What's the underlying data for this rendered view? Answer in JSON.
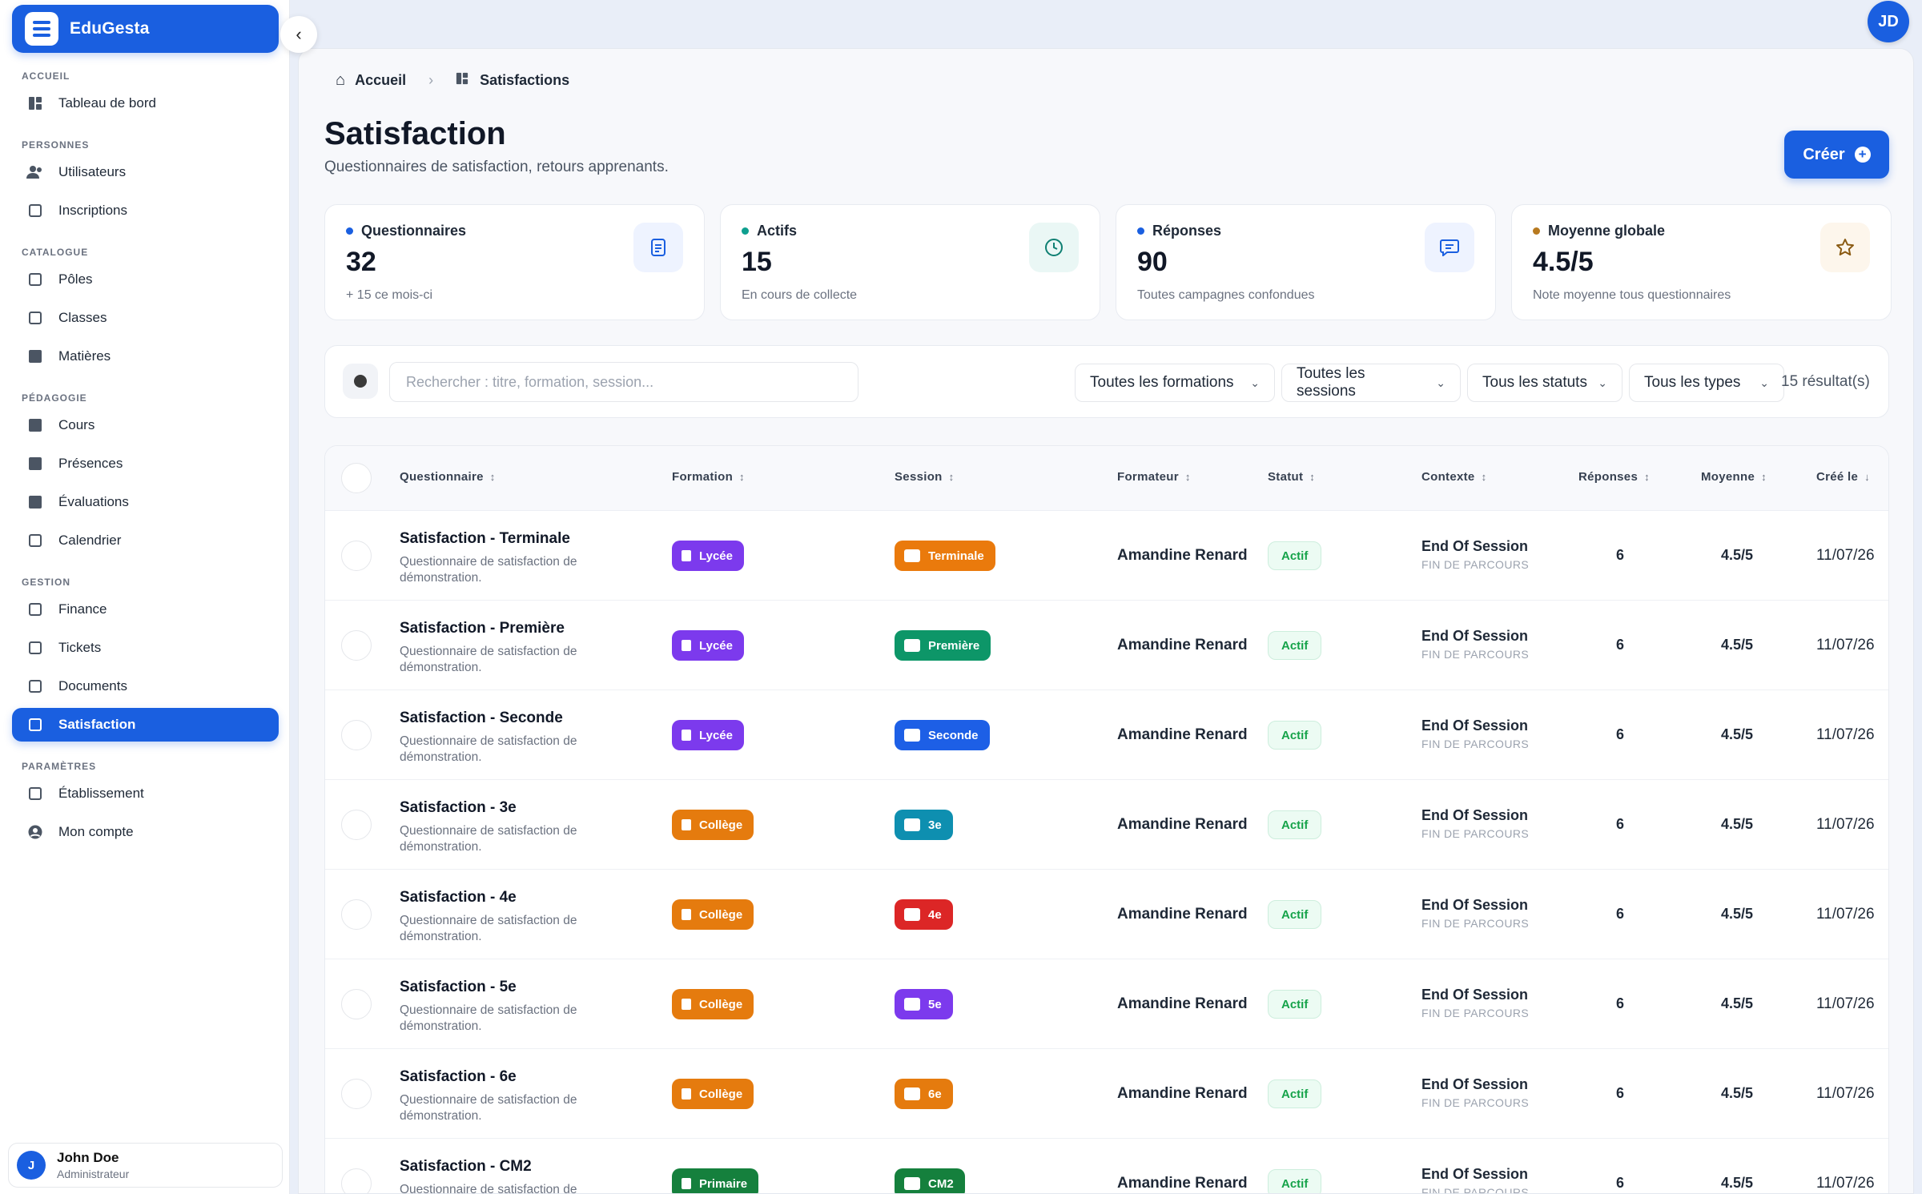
{
  "app": {
    "name": "EduGesta",
    "user_initials": "JD"
  },
  "sidebar": {
    "sections": [
      {
        "label": "ACCUEIL",
        "items": [
          {
            "label": "Tableau de bord",
            "icon": "dashboard-icon"
          }
        ]
      },
      {
        "label": "PERSONNES",
        "items": [
          {
            "label": "Utilisateurs",
            "icon": "users-icon"
          },
          {
            "label": "Inscriptions",
            "icon": "inscriptions-icon"
          }
        ]
      },
      {
        "label": "CATALOGUE",
        "items": [
          {
            "label": "Pôles",
            "icon": "poles-icon"
          },
          {
            "label": "Classes",
            "icon": "classes-icon"
          },
          {
            "label": "Matières",
            "icon": "book-icon"
          }
        ]
      },
      {
        "label": "PÉDAGOGIE",
        "items": [
          {
            "label": "Cours",
            "icon": "cubes-icon"
          },
          {
            "label": "Présences",
            "icon": "clipboard-icon"
          },
          {
            "label": "Évaluations",
            "icon": "evaluation-icon"
          },
          {
            "label": "Calendrier",
            "icon": "calendar-icon"
          }
        ]
      },
      {
        "label": "GESTION",
        "items": [
          {
            "label": "Finance",
            "icon": "wallet-icon"
          },
          {
            "label": "Tickets",
            "icon": "ticket-icon"
          },
          {
            "label": "Documents",
            "icon": "document-icon"
          },
          {
            "label": "Satisfaction",
            "icon": "chat-icon",
            "active": true
          }
        ]
      },
      {
        "label": "PARAMÈTRES",
        "items": [
          {
            "label": "Établissement",
            "icon": "building-icon"
          },
          {
            "label": "Mon compte",
            "icon": "account-icon"
          }
        ]
      }
    ],
    "user": {
      "initial": "J",
      "name": "John Doe",
      "role": "Administrateur"
    }
  },
  "breadcrumb": {
    "home": "Accueil",
    "current": "Satisfactions"
  },
  "page": {
    "title": "Satisfaction",
    "subtitle": "Questionnaires de satisfaction, retours apprenants.",
    "create_label": "Créer"
  },
  "kpis": [
    {
      "label": "Questionnaires",
      "value": "32",
      "note": "+ 15 ce mois-ci",
      "dot_color": "#1a5fe0",
      "icon": "document-icon",
      "icon_bg": "#eef3ff",
      "icon_color": "#1a5fe0"
    },
    {
      "label": "Actifs",
      "value": "15",
      "note": "En cours de collecte",
      "dot_color": "#0e9f8f",
      "icon": "clock-icon",
      "icon_bg": "#eaf7f5",
      "icon_color": "#0e7f72"
    },
    {
      "label": "Réponses",
      "value": "90",
      "note": "Toutes campagnes confondues",
      "dot_color": "#1a5fe0",
      "icon": "message-icon",
      "icon_bg": "#eef3ff",
      "icon_color": "#1a5fe0"
    },
    {
      "label": "Moyenne globale",
      "value": "4.5/5",
      "note": "Note moyenne tous questionnaires",
      "dot_color": "#b7791f",
      "icon": "star-icon",
      "icon_bg": "#fdf6ec",
      "icon_color": "#8a5a12"
    }
  ],
  "filters": {
    "search_placeholder": "Rechercher : titre, formation, session...",
    "formations": "Toutes les formations",
    "sessions": "Toutes les sessions",
    "statuts": "Tous les statuts",
    "types": "Tous les types",
    "results": "15 résultat(s)"
  },
  "table": {
    "columns": [
      "Questionnaire",
      "Formation",
      "Session",
      "Formateur",
      "Statut",
      "Contexte",
      "Réponses",
      "Moyenne",
      "Créé le"
    ],
    "rows": [
      {
        "title": "Satisfaction - Terminale",
        "desc": "Questionnaire de satisfaction de démonstration.",
        "formation": "Lycée",
        "formation_color": "#7c3aed",
        "session": "Terminale",
        "session_color": "#ea7a0c",
        "trainer": "Amandine Renard",
        "status": "Actif",
        "context": "End Of Session",
        "context_sub": "FIN DE PARCOURS",
        "responses": "6",
        "average": "4.5/5",
        "created": "11/07/26"
      },
      {
        "title": "Satisfaction - Première",
        "desc": "Questionnaire de satisfaction de démonstration.",
        "formation": "Lycée",
        "formation_color": "#7c3aed",
        "session": "Première",
        "session_color": "#0d9668",
        "trainer": "Amandine Renard",
        "status": "Actif",
        "context": "End Of Session",
        "context_sub": "FIN DE PARCOURS",
        "responses": "6",
        "average": "4.5/5",
        "created": "11/07/26"
      },
      {
        "title": "Satisfaction - Seconde",
        "desc": "Questionnaire de satisfaction de démonstration.",
        "formation": "Lycée",
        "formation_color": "#7c3aed",
        "session": "Seconde",
        "session_color": "#1d5fe6",
        "trainer": "Amandine Renard",
        "status": "Actif",
        "context": "End Of Session",
        "context_sub": "FIN DE PARCOURS",
        "responses": "6",
        "average": "4.5/5",
        "created": "11/07/26"
      },
      {
        "title": "Satisfaction - 3e",
        "desc": "Questionnaire de satisfaction de démonstration.",
        "formation": "Collège",
        "formation_color": "#e57b0e",
        "session": "3e",
        "session_color": "#0e8fb0",
        "trainer": "Amandine Renard",
        "status": "Actif",
        "context": "End Of Session",
        "context_sub": "FIN DE PARCOURS",
        "responses": "6",
        "average": "4.5/5",
        "created": "11/07/26"
      },
      {
        "title": "Satisfaction - 4e",
        "desc": "Questionnaire de satisfaction de démonstration.",
        "formation": "Collège",
        "formation_color": "#e57b0e",
        "session": "4e",
        "session_color": "#dc2626",
        "trainer": "Amandine Renard",
        "status": "Actif",
        "context": "End Of Session",
        "context_sub": "FIN DE PARCOURS",
        "responses": "6",
        "average": "4.5/5",
        "created": "11/07/26"
      },
      {
        "title": "Satisfaction - 5e",
        "desc": "Questionnaire de satisfaction de démonstration.",
        "formation": "Collège",
        "formation_color": "#e57b0e",
        "session": "5e",
        "session_color": "#7c3aed",
        "trainer": "Amandine Renard",
        "status": "Actif",
        "context": "End Of Session",
        "context_sub": "FIN DE PARCOURS",
        "responses": "6",
        "average": "4.5/5",
        "created": "11/07/26"
      },
      {
        "title": "Satisfaction - 6e",
        "desc": "Questionnaire de satisfaction de démonstration.",
        "formation": "Collège",
        "formation_color": "#e57b0e",
        "session": "6e",
        "session_color": "#e57b0e",
        "trainer": "Amandine Renard",
        "status": "Actif",
        "context": "End Of Session",
        "context_sub": "FIN DE PARCOURS",
        "responses": "6",
        "average": "4.5/5",
        "created": "11/07/26"
      },
      {
        "title": "Satisfaction - CM2",
        "desc": "Questionnaire de satisfaction de démonstration.",
        "formation": "Primaire",
        "formation_color": "#15803d",
        "session": "CM2",
        "session_color": "#15803d",
        "trainer": "Amandine Renard",
        "status": "Actif",
        "context": "End Of Session",
        "context_sub": "FIN DE PARCOURS",
        "responses": "6",
        "average": "4.5/5",
        "created": "11/07/26"
      }
    ]
  }
}
